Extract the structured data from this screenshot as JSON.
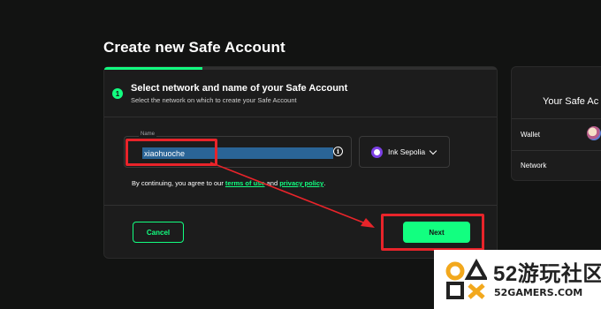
{
  "page_title": "Create new Safe Account",
  "progress": {
    "fraction": 0.25
  },
  "step": {
    "number": "1",
    "title": "Select network and name of your Safe Account",
    "subtitle": "Select the network on which to create your Safe Account"
  },
  "name_field": {
    "label": "Name",
    "value": "xiaohuoche",
    "icon": "info-icon"
  },
  "network_select": {
    "selected": "Ink Sepolia",
    "icon": "ink-network-icon"
  },
  "terms": {
    "prefix": "By continuing, you agree to our ",
    "terms_link": "terms of use",
    "middle": " and ",
    "privacy_link": "privacy policy",
    "suffix": "."
  },
  "buttons": {
    "cancel": "Cancel",
    "next": "Next"
  },
  "side_panel": {
    "title": "Your Safe Ac",
    "wallet_label": "Wallet",
    "network_label": "Network"
  },
  "watermark": {
    "title": "52游玩社区",
    "subtitle": "52GAMERS.COM"
  },
  "colors": {
    "accent": "#12ff80",
    "background": "#121312",
    "card": "#1c1c1c",
    "highlight": "#e8242a"
  }
}
